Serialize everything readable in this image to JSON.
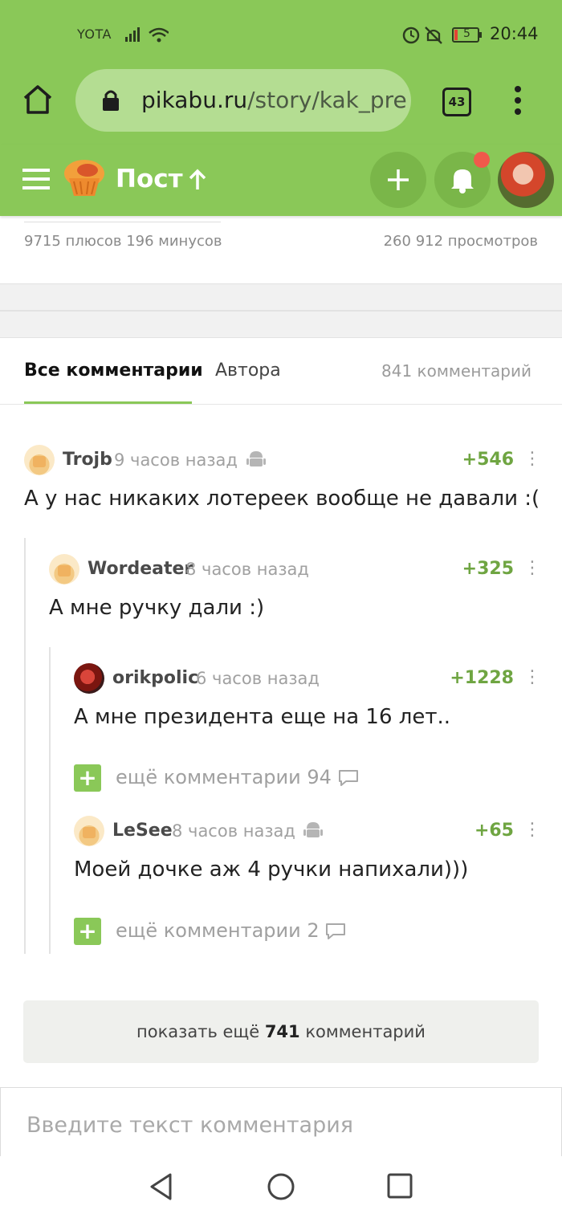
{
  "status_bar": {
    "carrier": "YOTA",
    "battery": "5",
    "time": "20:44"
  },
  "browser": {
    "url_domain": "pikabu.ru",
    "url_path": "/story/kak_pre",
    "tabs_count": "43"
  },
  "header": {
    "title": "Пост"
  },
  "post_stats": {
    "votes": "9715 плюсов 196 минусов",
    "views": "260 912 просмотров"
  },
  "comments_tabs": {
    "all_label": "Все комментарии",
    "author_label": "Автора",
    "count_label": "841 комментарий"
  },
  "comments": [
    {
      "author": "Trojb",
      "time": "9 часов назад",
      "score": "+546",
      "text": "А у нас никаких лотереек вообще не давали :("
    },
    {
      "author": "Wordeater",
      "time": "8 часов назад",
      "score": "+325",
      "text": "А мне ручку дали :)"
    },
    {
      "author": "orikpolic",
      "time": "6 часов назад",
      "score": "+1228",
      "text": "А мне президента еще на 16 лет.."
    },
    {
      "author": "LeSee",
      "time": "8 часов назад",
      "score": "+65",
      "text": "Моей дочке аж 4 ручки напихали)))"
    }
  ],
  "more_replies": [
    {
      "label": "ещё комментарии 94"
    },
    {
      "label": "ещё комментарии 2"
    }
  ],
  "show_more": {
    "prefix": "показать ещё",
    "count": "741",
    "suffix": "комментарий"
  },
  "comment_input": {
    "placeholder": "Введите текст комментария"
  },
  "colors": {
    "brand_green": "#8ac858",
    "score_green": "#6fa542",
    "notification_dot": "#f05a4b"
  },
  "icons": [
    "home-icon",
    "lock-icon",
    "tabs-icon",
    "menu-dots-icon",
    "hamburger-icon",
    "pikabu-logo",
    "arrow-up-icon",
    "plus-icon",
    "bell-icon",
    "android-icon",
    "comment-bubble-icon",
    "nav-back-icon",
    "nav-home-icon",
    "nav-recents-icon"
  ]
}
